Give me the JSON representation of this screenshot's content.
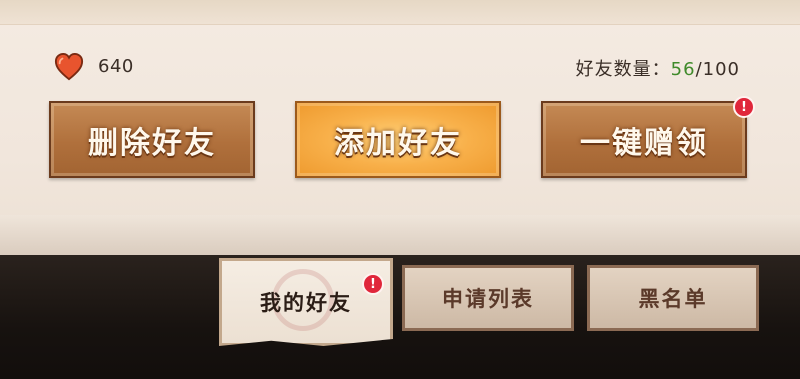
{
  "header": {
    "hearts": "640",
    "friends_label": "好友数量：",
    "friends_current": "56",
    "friends_sep_max": "/100"
  },
  "actions": {
    "delete_label": "删除好友",
    "add_label": "添加好友",
    "claim_label": "一键赠领",
    "claim_badge": "!"
  },
  "tabs": {
    "my_friends": "我的好友",
    "my_friends_badge": "!",
    "apply_list": "申请列表",
    "blacklist": "黑名单"
  },
  "icons": {
    "currency": "heart-icon",
    "notification": "exclamation-badge"
  },
  "colors": {
    "friends_current": "#3f8a2a",
    "button_brown": "#b0703c",
    "button_orange": "#f8b04a",
    "badge_red": "#e0263a"
  }
}
